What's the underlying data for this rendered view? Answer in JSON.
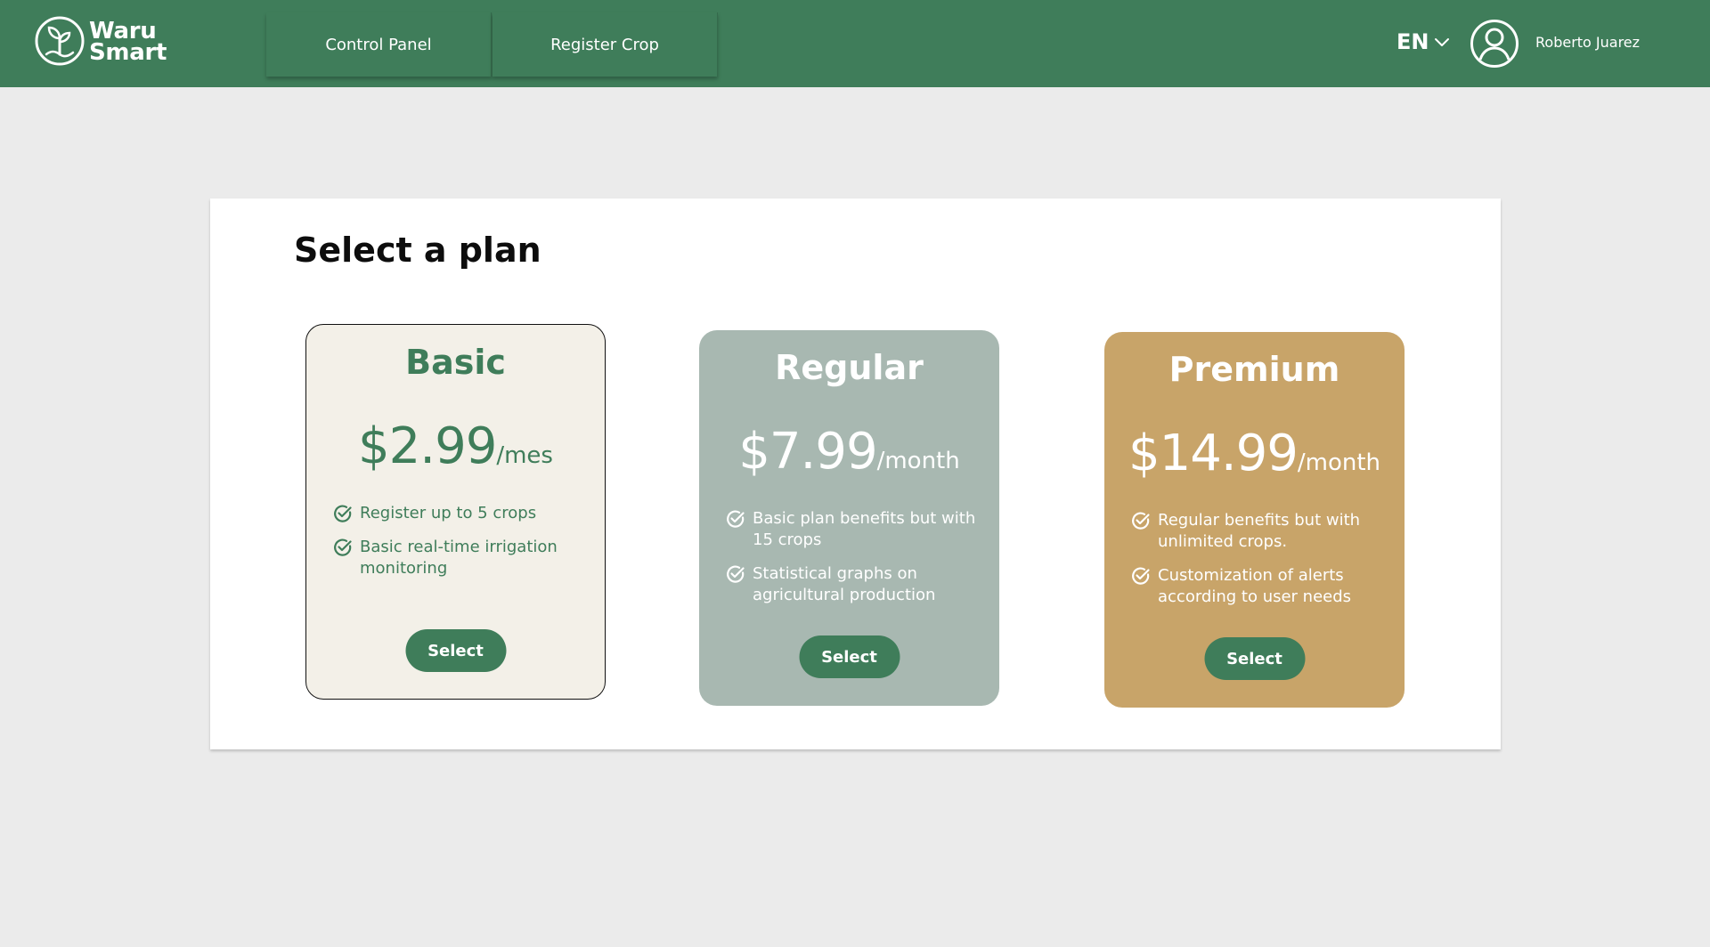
{
  "app": {
    "logo_line1": "Waru",
    "logo_line2": "Smart",
    "logo_icon": "plant-leaf-icon"
  },
  "nav": {
    "items": [
      {
        "label": "Control Panel"
      },
      {
        "label": "Register Crop"
      }
    ]
  },
  "header": {
    "language": "EN",
    "user_name": "Roberto Juarez"
  },
  "main": {
    "title": "Select a plan",
    "plans": [
      {
        "name": "Basic",
        "price": "$2.99",
        "period": "/mes",
        "features": [
          "Register up to 5 crops",
          "Basic real-time irrigation monitoring"
        ],
        "button": "Select"
      },
      {
        "name": "Regular",
        "price": "$7.99",
        "period": "/month",
        "features": [
          "Basic plan benefits but with 15 crops",
          "Statistical graphs on agricultural production"
        ],
        "button": "Select"
      },
      {
        "name": "Premium",
        "price": "$14.99",
        "period": "/month",
        "features": [
          "Regular benefits but with unlimited crops.",
          "Customization of alerts according to user needs"
        ],
        "button": "Select"
      }
    ]
  },
  "colors": {
    "brand_green": "#3f7d5a",
    "background": "#ebebeb",
    "basic_card": "#f3f0e8",
    "regular_card": "#a8b8b1",
    "premium_card": "#c8a469"
  }
}
